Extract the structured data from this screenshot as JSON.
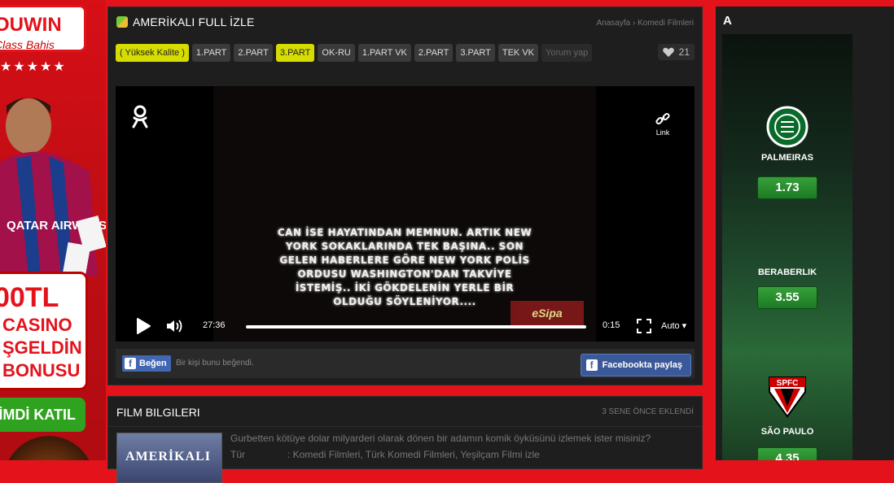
{
  "left_ad": {
    "brand": "OUWIN",
    "tagline": "Class Bahis",
    "stars": "★★★★★",
    "shirt_text": "QATAR AIRWAYS",
    "bonus_amount": "00TL",
    "bonus_lines": [
      "CASINO",
      "ŞGELDİN",
      "BONUSU"
    ],
    "cta": "İMDİ KATIL"
  },
  "player": {
    "title": "AMERİKALI FULL İZLE",
    "breadcrumb": "Anasayfa › Komedi Filmleri",
    "tabs": [
      {
        "label": "( Yüksek Kalite )",
        "style": "hi"
      },
      {
        "label": "1.PART",
        "style": "normal"
      },
      {
        "label": "2.PART",
        "style": "normal"
      },
      {
        "label": "3.PART",
        "style": "hi"
      },
      {
        "label": "OK-RU",
        "style": "normal"
      },
      {
        "label": "1.PART VK",
        "style": "normal"
      },
      {
        "label": "2.PART",
        "style": "normal"
      },
      {
        "label": "3.PART",
        "style": "normal"
      },
      {
        "label": "TEK VK",
        "style": "normal"
      },
      {
        "label": "Yorum yap",
        "style": "muted"
      }
    ],
    "likes": "21",
    "video": {
      "subtitle_lines": [
        "CAN İSE HAYATINDAN MEMNUN. ARTIK NEW",
        "YORK SOKAKLARINDA TEK BAŞINA.. SON",
        "GELEN HABERLERE GÖRE NEW YORK POLİS",
        "ORDUSU WASHINGTON'DAN TAKVİYE",
        "İSTEMİŞ.. İKİ GÖKDELENİN YERLE BİR",
        "OLDUĞU SÖYLENİYOR...."
      ],
      "watermark": "eSipa",
      "link_label": "Link",
      "time_current": "27:36",
      "time_remaining": "0:15",
      "quality": "Auto ▾"
    },
    "social": {
      "like_button": "Beğen",
      "like_text": "Bir kişi bunu beğendi.",
      "share_button": "Facebookta paylaş"
    }
  },
  "film_info": {
    "title": "FILM BILGILERI",
    "date": "3 SENE ÖNCE EKLENDİ",
    "poster_text": "AMERİKALI",
    "description": "Gurbetten kötüye dolar milyarderi olarak dönen bir adamın komik öyküsünü izlemek ister misiniz?",
    "genre_label": "Tür",
    "genre_value": ": Komedi Filmleri, Türk Komedi Filmleri, Yeşilçam Filmi izle"
  },
  "right_panel": {
    "title": "A",
    "matches": [
      {
        "team": "PALMEIRAS",
        "odd": "1.73"
      },
      {
        "team": "BERABERLIK",
        "odd": "3.55"
      },
      {
        "team": "SÃO PAULO",
        "odd": "4.35"
      }
    ]
  },
  "colors": {
    "brand_red": "#e4121b",
    "tab_highlight": "#d6dc00",
    "facebook_blue": "#3b5998",
    "odd_green": "#2e9a34"
  }
}
